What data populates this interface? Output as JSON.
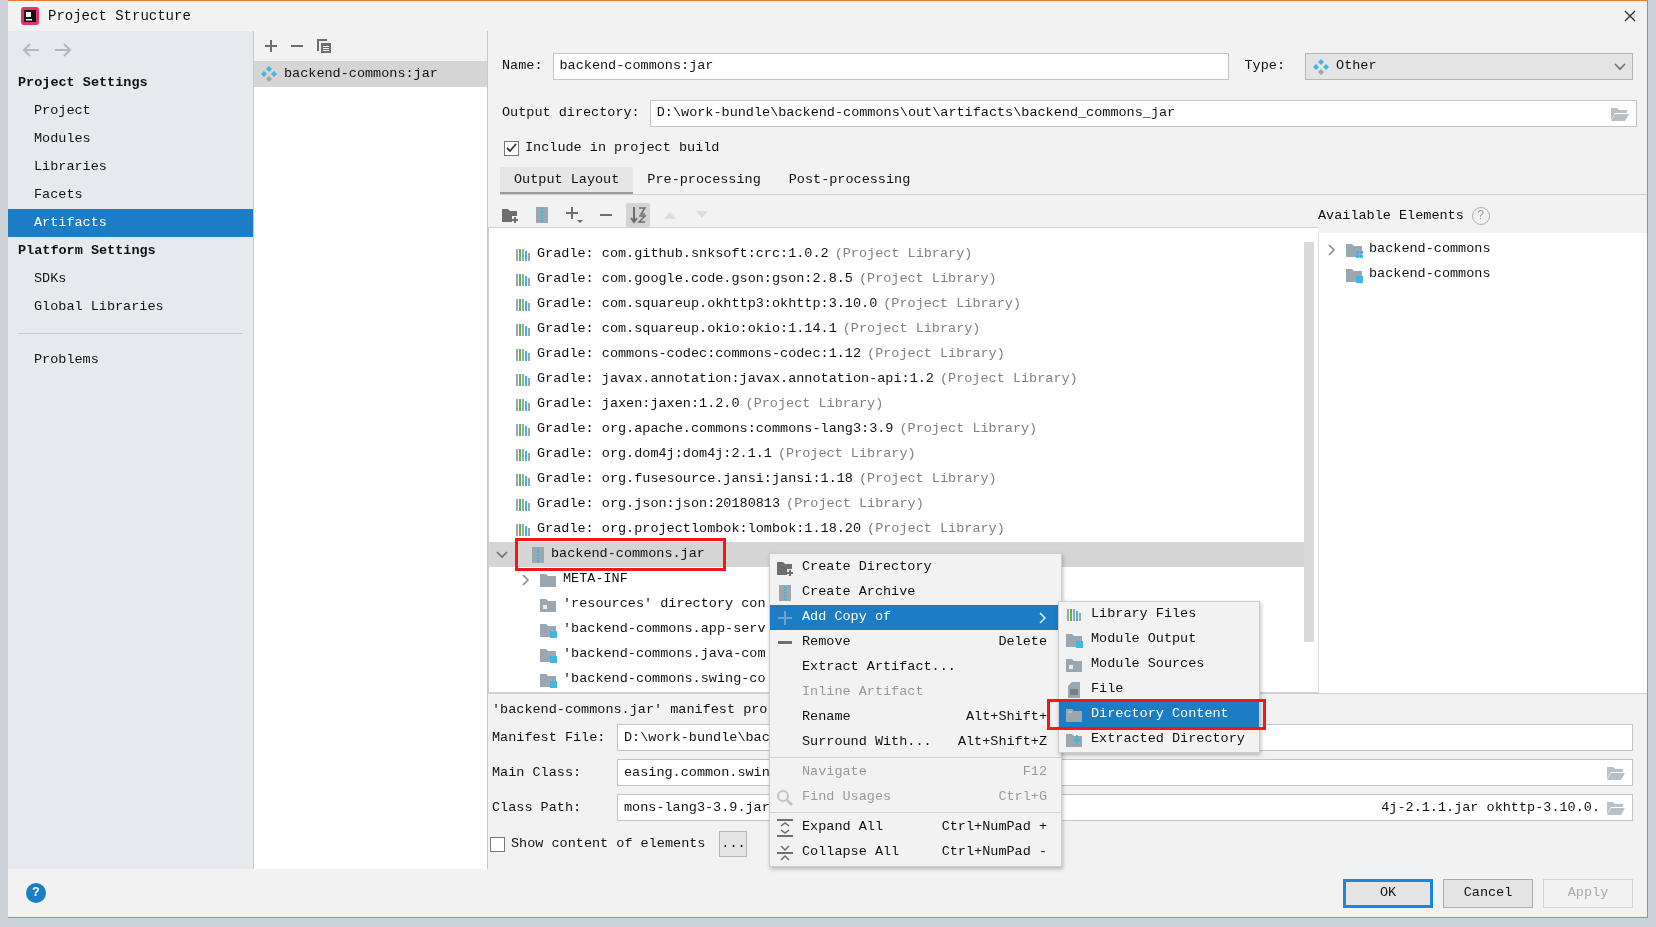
{
  "window": {
    "title": "Project Structure"
  },
  "sidebar": {
    "sections": [
      {
        "heading": "Project Settings",
        "items": [
          {
            "label": "Project",
            "selected": false
          },
          {
            "label": "Modules",
            "selected": false
          },
          {
            "label": "Libraries",
            "selected": false
          },
          {
            "label": "Facets",
            "selected": false
          },
          {
            "label": "Artifacts",
            "selected": true
          }
        ]
      },
      {
        "heading": "Platform Settings",
        "items": [
          {
            "label": "SDKs",
            "selected": false
          },
          {
            "label": "Global Libraries",
            "selected": false
          }
        ]
      }
    ],
    "bottom_items": [
      {
        "label": "Problems",
        "selected": false
      }
    ]
  },
  "artifacts": [
    {
      "label": "backend-commons:jar",
      "selected": true
    }
  ],
  "form": {
    "name_label": "Name:",
    "name_value": "backend-commons:jar",
    "type_label": "Type:",
    "type_value": "Other",
    "output_label": "Output directory:",
    "output_value": "D:\\work-bundle\\backend-commons\\out\\artifacts\\backend_commons_jar",
    "include": {
      "label": "Include in project build",
      "checked": true
    }
  },
  "tabs": [
    {
      "label": "Output Layout",
      "selected": true
    },
    {
      "label": "Pre-processing",
      "selected": false
    },
    {
      "label": "Post-processing",
      "selected": false
    }
  ],
  "layout_toolbar": [
    {
      "kind": "new-folder",
      "pressed": false,
      "disabled": false
    },
    {
      "kind": "archive",
      "pressed": false,
      "disabled": false
    },
    {
      "kind": "add",
      "pressed": false,
      "disabled": false
    },
    {
      "kind": "remove",
      "pressed": false,
      "disabled": false
    },
    {
      "kind": "sort",
      "pressed": true,
      "disabled": false
    },
    {
      "kind": "up",
      "pressed": false,
      "disabled": true
    },
    {
      "kind": "down",
      "pressed": false,
      "disabled": true
    }
  ],
  "layout_tree": [
    {
      "kind": "library",
      "label": "Gradle: com.github.snksoft:crc:1.0.2",
      "note": "(Project Library)"
    },
    {
      "kind": "library",
      "label": "Gradle: com.google.code.gson:gson:2.8.5",
      "note": "(Project Library)"
    },
    {
      "kind": "library",
      "label": "Gradle: com.squareup.okhttp3:okhttp:3.10.0",
      "note": "(Project Library)"
    },
    {
      "kind": "library",
      "label": "Gradle: com.squareup.okio:okio:1.14.1",
      "note": "(Project Library)"
    },
    {
      "kind": "library",
      "label": "Gradle: commons-codec:commons-codec:1.12",
      "note": "(Project Library)"
    },
    {
      "kind": "library",
      "label": "Gradle: javax.annotation:javax.annotation-api:1.2",
      "note": "(Project Library)"
    },
    {
      "kind": "library",
      "label": "Gradle: jaxen:jaxen:1.2.0",
      "note": "(Project Library)"
    },
    {
      "kind": "library",
      "label": "Gradle: org.apache.commons:commons-lang3:3.9",
      "note": "(Project Library)"
    },
    {
      "kind": "library",
      "label": "Gradle: org.dom4j:dom4j:2.1.1",
      "note": "(Project Library)"
    },
    {
      "kind": "library",
      "label": "Gradle: org.fusesource.jansi:jansi:1.18",
      "note": "(Project Library)"
    },
    {
      "kind": "library",
      "label": "Gradle: org.json:json:20180813",
      "note": "(Project Library)"
    },
    {
      "kind": "library",
      "label": "Gradle: org.projectlombok:lombok:1.18.20",
      "note": "(Project Library)"
    },
    {
      "kind": "archive",
      "label": "backend-commons.jar",
      "expanded": true,
      "selected": true,
      "annotated": true,
      "children": [
        {
          "kind": "folder",
          "label": "META-INF",
          "expanded": false
        },
        {
          "kind": "sources",
          "label": "'resources' directory con"
        },
        {
          "kind": "module-output",
          "label": "'backend-commons.app-serv"
        },
        {
          "kind": "module-output",
          "label": "'backend-commons.java-com"
        },
        {
          "kind": "module-output",
          "label": "'backend-commons.swing-co"
        }
      ]
    }
  ],
  "available_elements": {
    "title": "Available Elements",
    "help": "?",
    "items": [
      {
        "kind": "module",
        "label": "backend-commons",
        "expandable": true
      },
      {
        "kind": "module-output",
        "label": "backend-commons",
        "expandable": false
      }
    ]
  },
  "manifest": {
    "title": "'backend-commons.jar' manifest pro",
    "fields": [
      {
        "label": "Manifest File:",
        "value": "D:\\work-bundle\\bac",
        "browse": false
      },
      {
        "label": "Main Class:",
        "value": "easing.common.swin",
        "browse": true
      },
      {
        "label": "Class Path:",
        "value": "mons-lang3-3.9.jar",
        "tail": "4j-2.1.1.jar okhttp-3.10.0.",
        "browse": true
      }
    ]
  },
  "show_content": {
    "label": "Show content of elements",
    "checked": false,
    "button": "..."
  },
  "context_menu": [
    {
      "kind": "new-directory",
      "label": "Create Directory",
      "disabled": false,
      "selected": false
    },
    {
      "kind": "new-archive",
      "label": "Create Archive",
      "disabled": false,
      "selected": false
    },
    {
      "kind": "add",
      "label": "Add Copy of",
      "disabled": false,
      "selected": true,
      "submenu": true
    },
    {
      "kind": "remove",
      "label": "Remove",
      "shortcut": "Delete",
      "disabled": false,
      "selected": false
    },
    {
      "kind": "plain",
      "label": "Extract Artifact...",
      "disabled": false,
      "selected": false
    },
    {
      "kind": "plain",
      "label": "Inline Artifact",
      "disabled": true,
      "selected": false
    },
    {
      "kind": "plain",
      "label": "Rename",
      "shortcut": "Alt+Shift+",
      "disabled": false,
      "selected": false
    },
    {
      "kind": "plain",
      "label": "Surround With...",
      "shortcut": "Alt+Shift+Z",
      "disabled": false,
      "selected": false
    },
    {
      "kind": "separator"
    },
    {
      "kind": "plain",
      "label": "Navigate",
      "shortcut": "F12",
      "disabled": true,
      "selected": false
    },
    {
      "kind": "search",
      "label": "Find Usages",
      "shortcut": "Ctrl+G",
      "disabled": true,
      "selected": false
    },
    {
      "kind": "separator"
    },
    {
      "kind": "expand",
      "label": "Expand All",
      "shortcut": "Ctrl+NumPad +",
      "disabled": false,
      "selected": false
    },
    {
      "kind": "collapse",
      "label": "Collapse All",
      "shortcut": "Ctrl+NumPad -",
      "disabled": false,
      "selected": false
    }
  ],
  "submenu": [
    {
      "kind": "library",
      "label": "Library Files",
      "selected": false,
      "annotated": false
    },
    {
      "kind": "module-output",
      "label": "Module Output",
      "selected": false,
      "annotated": false
    },
    {
      "kind": "sources",
      "label": "Module Sources",
      "selected": false,
      "annotated": false
    },
    {
      "kind": "file",
      "label": "File",
      "selected": false,
      "annotated": false
    },
    {
      "kind": "directory",
      "label": "Directory Content",
      "selected": true,
      "annotated": true
    },
    {
      "kind": "extracted",
      "label": "Extracted Directory",
      "selected": false,
      "annotated": false
    }
  ],
  "help": "?",
  "buttons": [
    {
      "label": "OK",
      "default": true,
      "disabled": false
    },
    {
      "label": "Cancel",
      "default": false,
      "disabled": false
    },
    {
      "label": "Apply",
      "default": false,
      "disabled": true
    }
  ]
}
